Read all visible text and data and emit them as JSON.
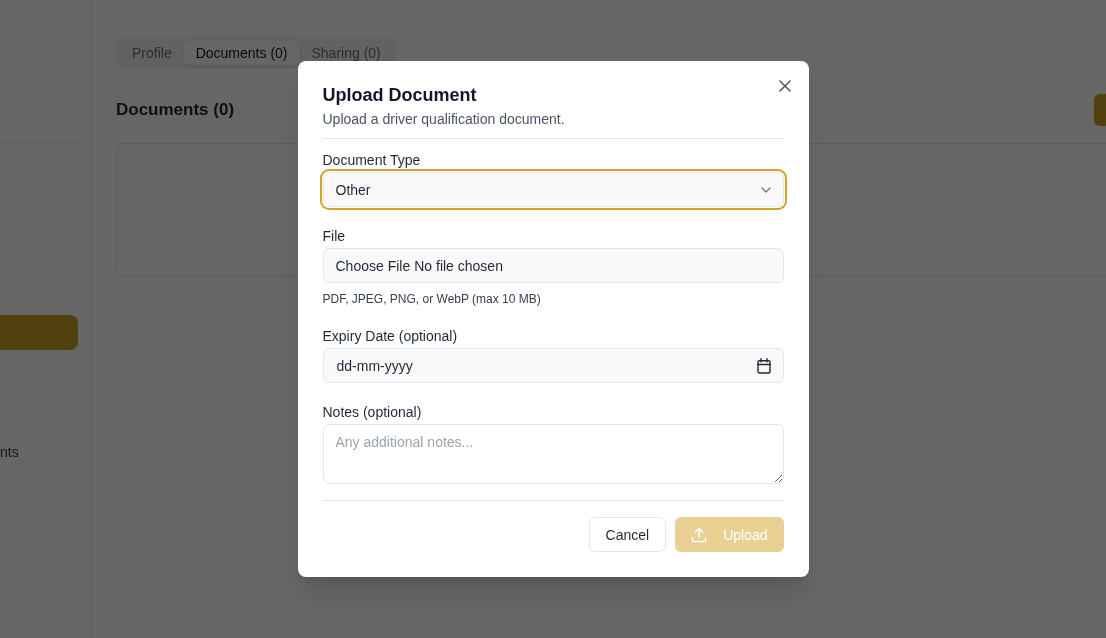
{
  "sidebar": {
    "items": [
      {
        "label": "nts"
      }
    ]
  },
  "tabs": [
    {
      "label": "Profile",
      "selected": false
    },
    {
      "label": "Documents (0)",
      "selected": true
    },
    {
      "label": "Sharing (0)",
      "selected": false
    }
  ],
  "section": {
    "title": "Documents (0)"
  },
  "dialog": {
    "title": "Upload Document",
    "subtitle": "Upload a driver qualification document.",
    "fields": [
      {
        "kind": "select",
        "label": "Document Type",
        "value": "Other",
        "focused": true
      },
      {
        "kind": "file",
        "label": "File",
        "button_label": "Choose File",
        "status": "No file chosen",
        "hint": "PDF, JPEG, PNG, or WebP (max 10 MB)"
      },
      {
        "kind": "date",
        "label": "Expiry Date (optional)",
        "placeholder": "dd-mm-yyyy"
      },
      {
        "kind": "textarea",
        "label": "Notes (optional)",
        "placeholder": "Any additional notes..."
      }
    ],
    "buttons": [
      {
        "label": "Cancel",
        "kind": "secondary",
        "disabled": false
      },
      {
        "label": "Upload",
        "kind": "primary",
        "disabled": true
      }
    ]
  }
}
